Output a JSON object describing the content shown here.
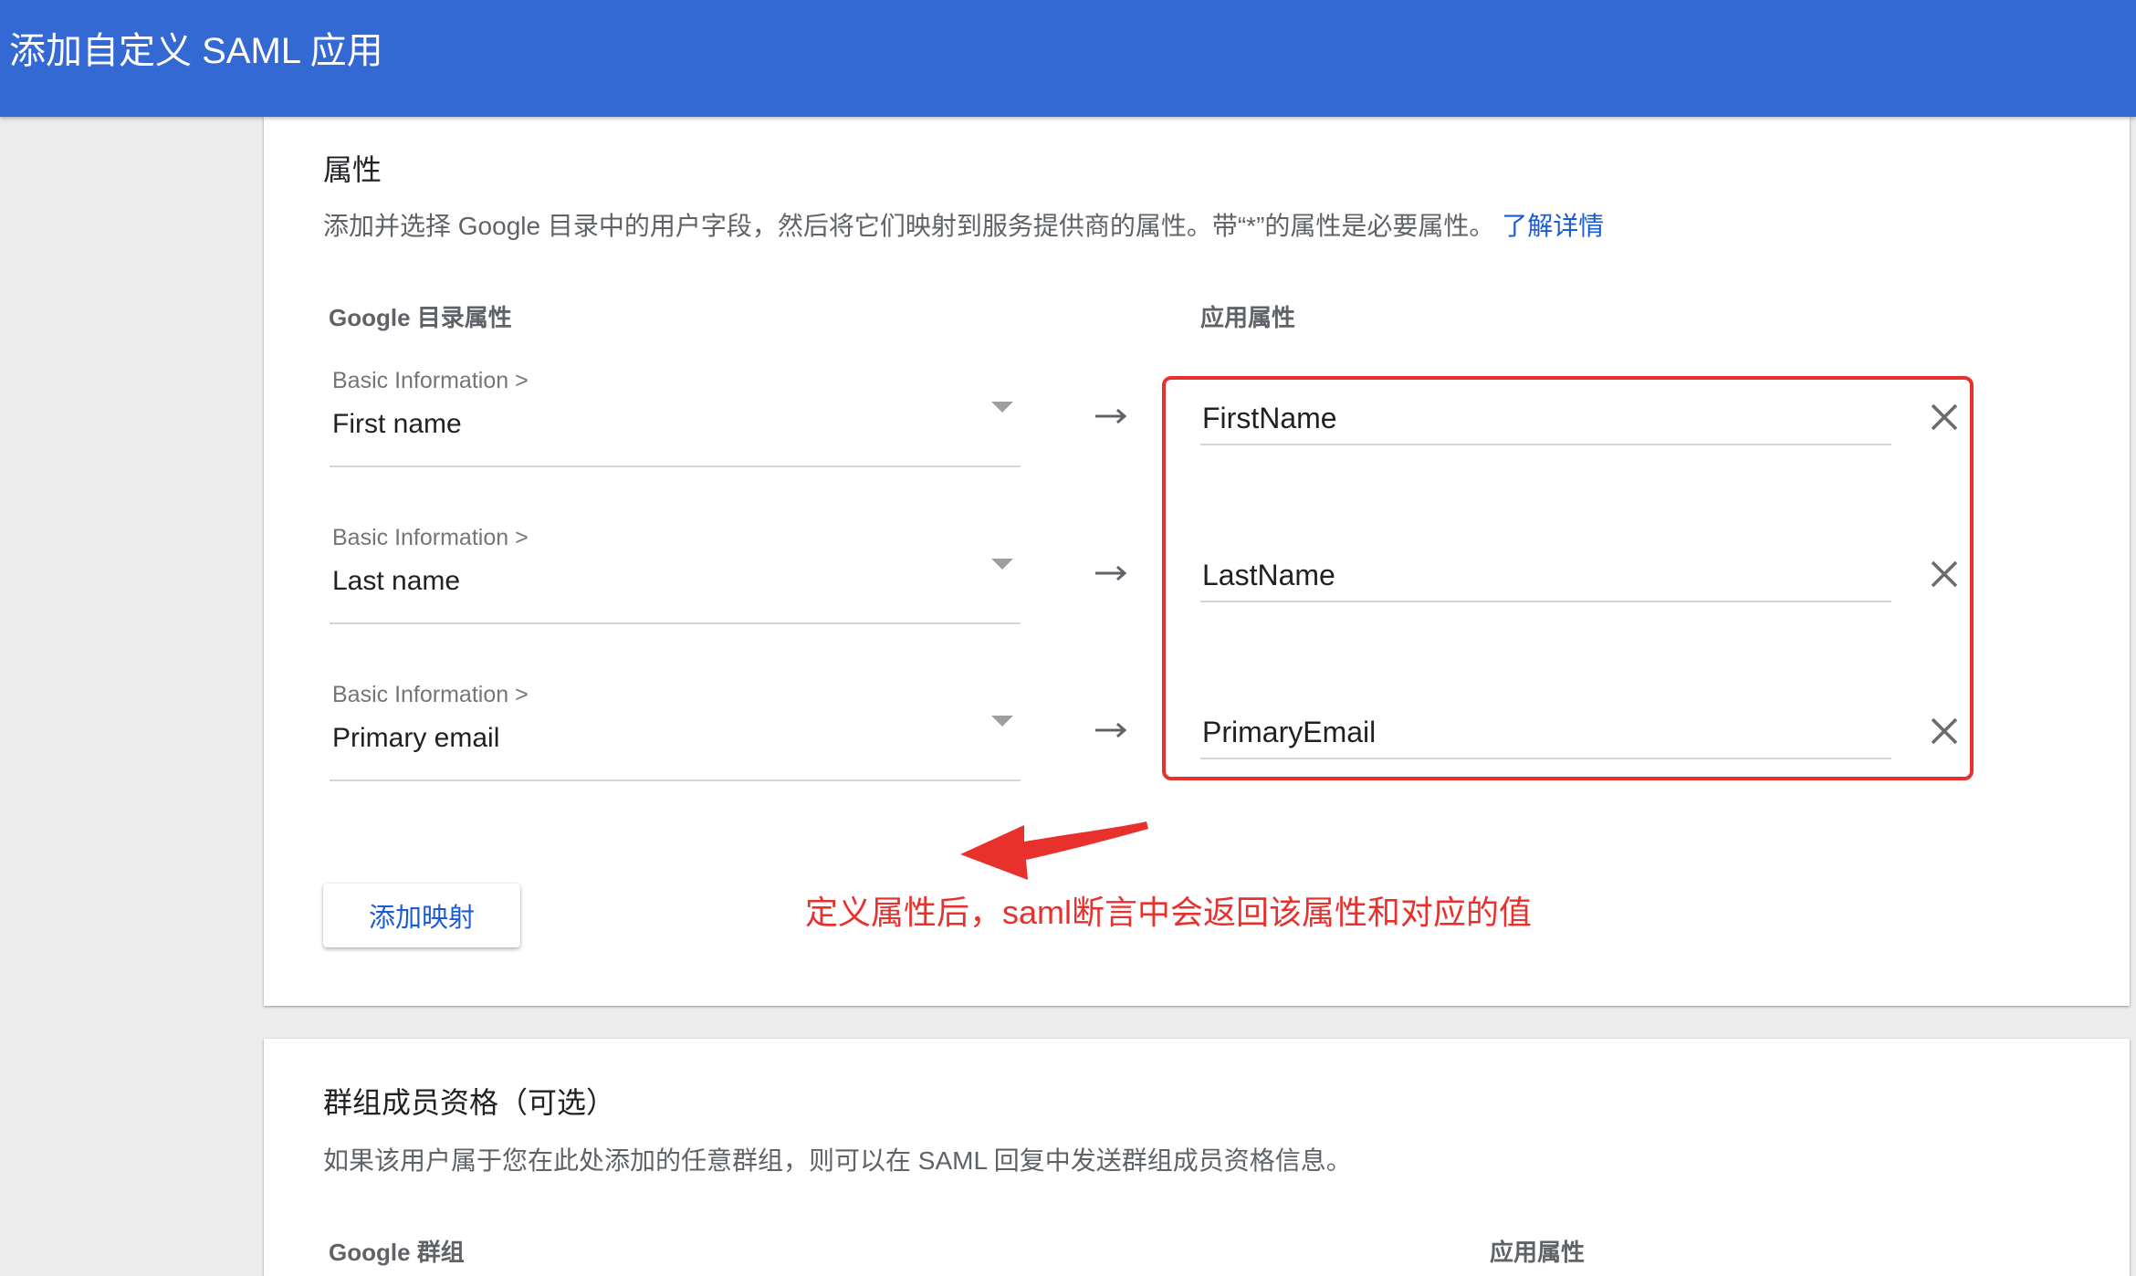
{
  "header": {
    "title": "添加自定义 SAML 应用"
  },
  "attributes": {
    "title": "属性",
    "description": "添加并选择 Google 目录中的用户字段，然后将它们映射到服务提供商的属性。带“*”的属性是必要属性。",
    "learn_more": "了解详情",
    "directory_header": "Google 目录属性",
    "app_header": "应用属性",
    "mappings": [
      {
        "category": "Basic Information >",
        "field": "First name",
        "app_attribute": "FirstName"
      },
      {
        "category": "Basic Information >",
        "field": "Last name",
        "app_attribute": "LastName"
      },
      {
        "category": "Basic Information >",
        "field": "Primary email",
        "app_attribute": "PrimaryEmail"
      }
    ],
    "add_mapping_label": "添加映射"
  },
  "annotation": {
    "text": "定义属性后，saml断言中会返回该属性和对应的值",
    "color": "#e8312c"
  },
  "groups": {
    "title": "群组成员资格（可选）",
    "description": "如果该用户属于您在此处添加的任意群组，则可以在 SAML 回复中发送群组成员资格信息。",
    "google_groups_header": "Google 群组",
    "app_header": "应用属性"
  },
  "colors": {
    "header_bg": "#3469d4",
    "link": "#1a5bd6",
    "highlight": "#e8312c"
  }
}
